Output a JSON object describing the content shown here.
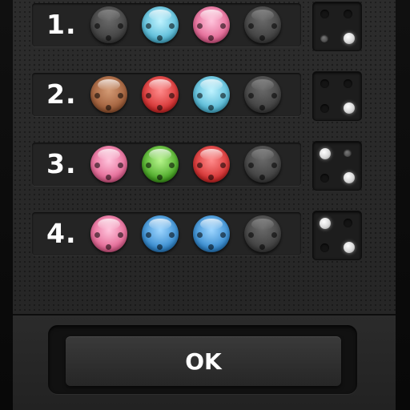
{
  "rows": [
    {
      "label": "1.",
      "pegs": [
        "gray",
        "cyan",
        "pink",
        "gray"
      ],
      "hints": [
        "empty",
        "empty",
        "dark",
        "white"
      ]
    },
    {
      "label": "2.",
      "pegs": [
        "brown",
        "red",
        "cyan",
        "gray"
      ],
      "hints": [
        "empty",
        "empty",
        "empty",
        "white"
      ]
    },
    {
      "label": "3.",
      "pegs": [
        "pink",
        "green",
        "red",
        "gray"
      ],
      "hints": [
        "white",
        "dark",
        "empty",
        "white"
      ]
    },
    {
      "label": "4.",
      "pegs": [
        "pink",
        "blue",
        "blue",
        "gray"
      ],
      "hints": [
        "white",
        "empty",
        "empty",
        "white"
      ]
    }
  ],
  "ok_button": {
    "label": "OK"
  }
}
